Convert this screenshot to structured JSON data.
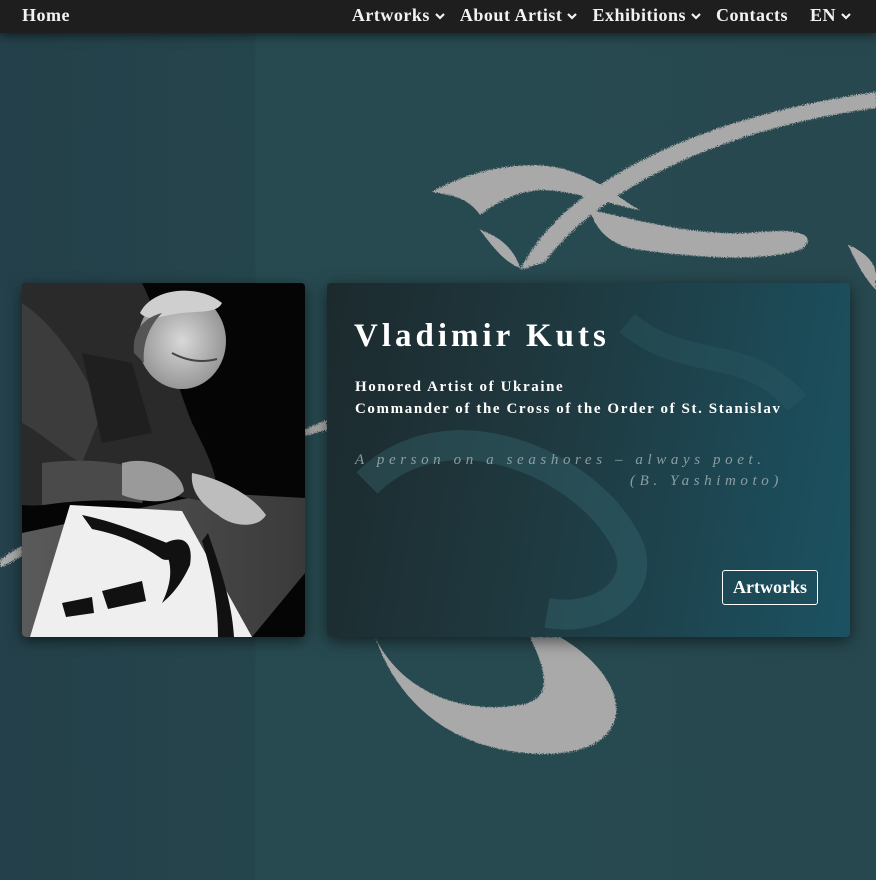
{
  "nav": {
    "home": "Home",
    "items": [
      {
        "label": "Artworks",
        "icon": "chevron-down-icon"
      },
      {
        "label": "About Artist",
        "icon": "chevron-down-icon"
      },
      {
        "label": "Exhibitions",
        "icon": "chevron-down-icon"
      },
      {
        "label": "Contacts"
      },
      {
        "label": "EN",
        "icon": "chevron-down-icon"
      }
    ]
  },
  "hero": {
    "name": "Vladimir Kuts",
    "titles": [
      "Honored Artist of Ukraine",
      "Commander of the Cross of the Order of St. Stanislav"
    ],
    "quote": "A person on a seashores – always poet.",
    "quote_author": "(B. Yashimoto)",
    "button_label": "Artworks"
  },
  "colors": {
    "navbar": "#1e1e1e",
    "background": "#25464c",
    "brush": "#a8a8a8",
    "card_accent": "#1b5262",
    "quote_text": "#8c9ea2"
  }
}
